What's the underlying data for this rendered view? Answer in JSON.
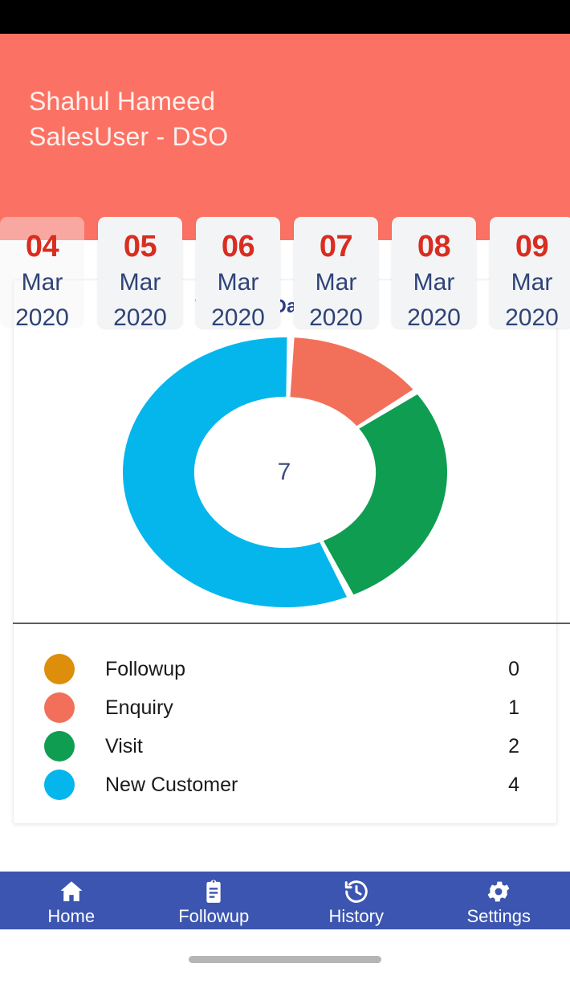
{
  "status_bar": {
    "background": "#000000"
  },
  "header": {
    "background": "#FB7264",
    "user_name": "Shahul Hameed",
    "user_role": "SalesUser - DSO"
  },
  "date_strip": {
    "dates": [
      {
        "day": "04",
        "month": "Mar",
        "year": "2020",
        "state": "faded"
      },
      {
        "day": "05",
        "month": "Mar",
        "year": "2020",
        "state": "normal"
      },
      {
        "day": "06",
        "month": "Mar",
        "year": "2020",
        "state": "normal"
      },
      {
        "day": "07",
        "month": "Mar",
        "year": "2020",
        "state": "normal"
      },
      {
        "day": "08",
        "month": "Mar",
        "year": "2020",
        "state": "normal"
      },
      {
        "day": "09",
        "month": "Mar",
        "year": "2020",
        "state": "clipped"
      }
    ]
  },
  "dashboard": {
    "title": "Today's Dashboard",
    "center_total": "7"
  },
  "chart_data": {
    "type": "pie",
    "title": "Today's Dashboard",
    "categories": [
      "Followup",
      "Enquiry",
      "Visit",
      "New Customer"
    ],
    "values": [
      0,
      1,
      2,
      4
    ],
    "colors": [
      "#DD8E0B",
      "#F2705A",
      "#0F9D52",
      "#04B6EC"
    ],
    "total": 7,
    "center_label": "7",
    "donut": true,
    "inner_radius_ratio": 0.56,
    "legend_position": "bottom",
    "grid": false
  },
  "legend": {
    "rows": [
      {
        "label": "Followup",
        "value": "0",
        "color": "#DD8E0B"
      },
      {
        "label": "Enquiry",
        "value": "1",
        "color": "#F2705A"
      },
      {
        "label": "Visit",
        "value": "2",
        "color": "#0F9D52"
      },
      {
        "label": "New Customer",
        "value": "4",
        "color": "#04B6EC"
      }
    ]
  },
  "bottom_nav": {
    "background": "#3B55B0",
    "items": [
      {
        "label": "Home",
        "icon": "home-icon"
      },
      {
        "label": "Followup",
        "icon": "clipboard-icon"
      },
      {
        "label": "History",
        "icon": "history-clock-icon"
      },
      {
        "label": "Settings",
        "icon": "gear-icon"
      }
    ]
  }
}
